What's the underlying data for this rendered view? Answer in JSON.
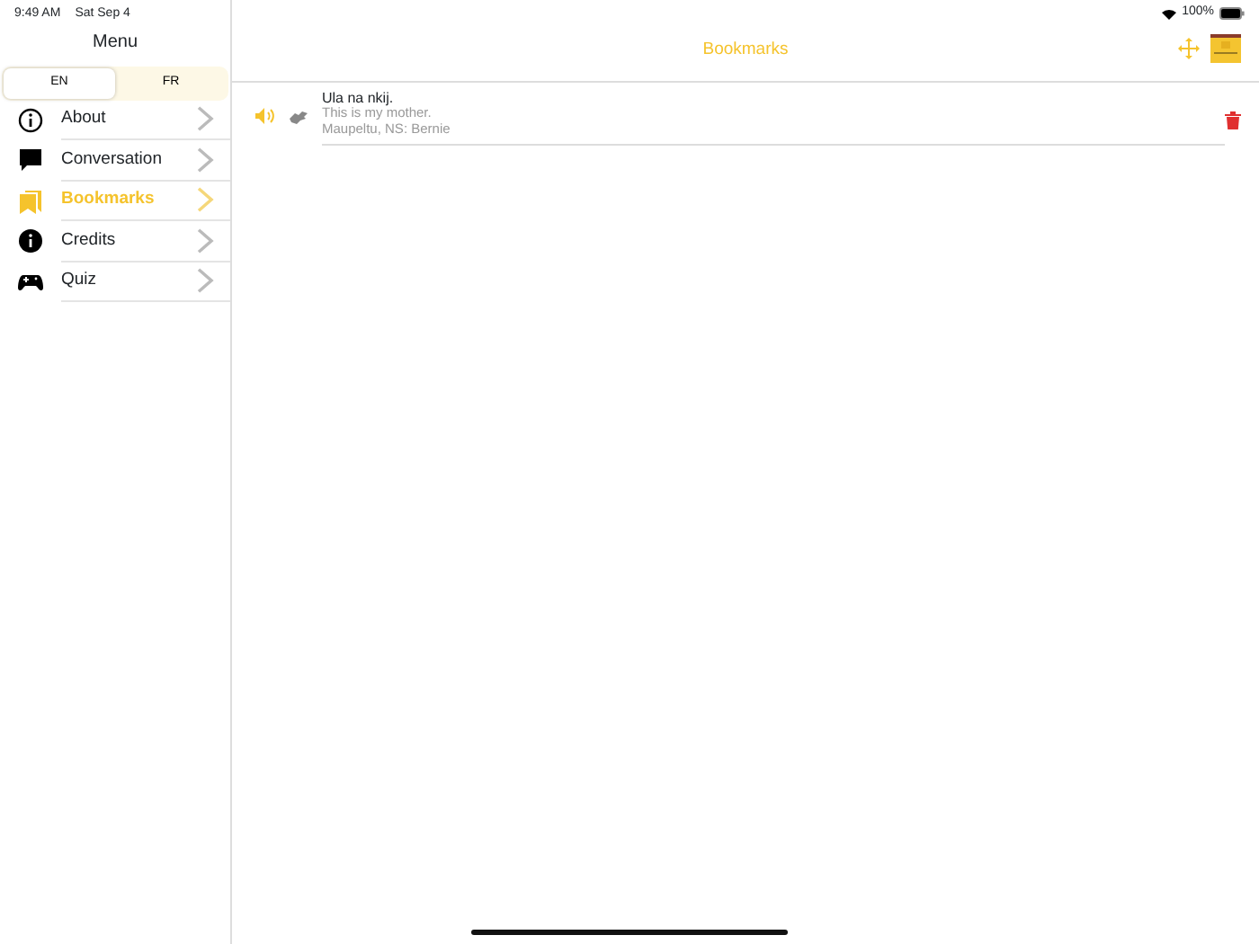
{
  "status_bar": {
    "time": "9:49 AM",
    "date": "Sat Sep 4",
    "battery": "100%"
  },
  "sidebar": {
    "title": "Menu",
    "segments": [
      {
        "label": "EN",
        "selected": true
      },
      {
        "label": "FR",
        "selected": false
      }
    ],
    "items": [
      {
        "label": "About",
        "selected": false
      },
      {
        "label": "Conversation",
        "selected": false
      },
      {
        "label": "Bookmarks",
        "selected": true
      },
      {
        "label": "Credits",
        "selected": false
      },
      {
        "label": "Quiz",
        "selected": false
      }
    ]
  },
  "main": {
    "title": "Bookmarks",
    "bookmarks": [
      {
        "phrase": "Ula na nkij.",
        "translation": "This is my mother.",
        "source": "Maupeltu, NS: Bernie"
      }
    ]
  }
}
